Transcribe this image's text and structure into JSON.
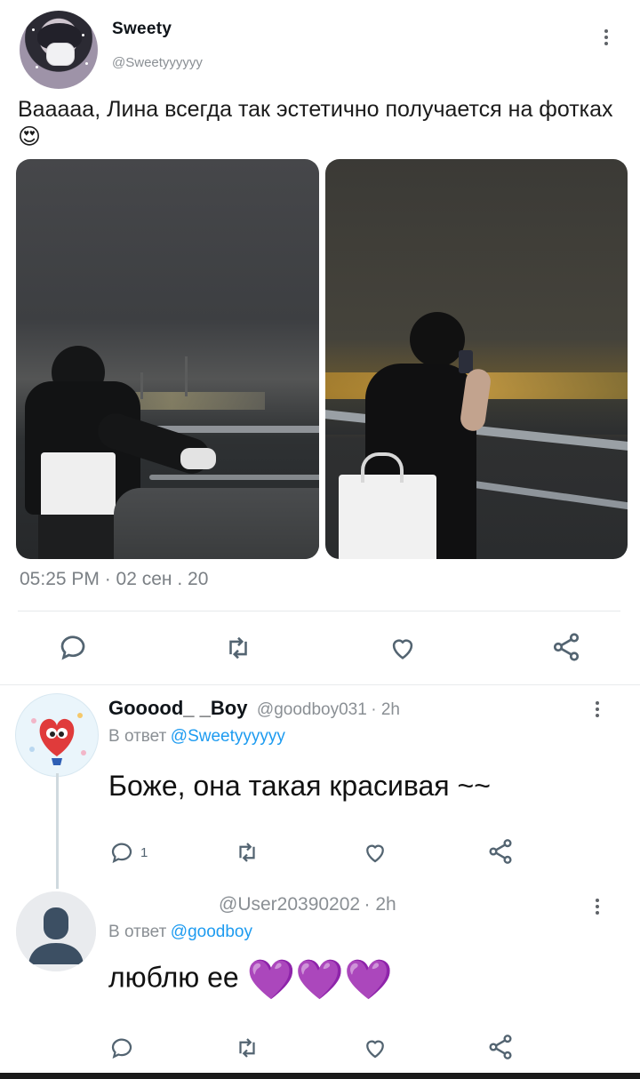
{
  "main_tweet": {
    "author_name": "Sweety",
    "author_handle": "@Sweetyyyyyy",
    "text": "Вааааа, Лина всегда так эстетично получается на фотках",
    "emoji": "😍",
    "timestamp": "05:25 PM · 02 сен . 20"
  },
  "replies": [
    {
      "author_name": "Gooood_ _Boy",
      "author_handle": "@goodboy031",
      "time": "· 2h",
      "reply_to_label": "В ответ",
      "reply_to_handle": "@Sweetyyyyyy",
      "text": "Боже, она такая красивая ~~",
      "reply_count": "1"
    },
    {
      "author_name": "",
      "author_handle": "@User20390202",
      "time": "· 2h",
      "reply_to_label": "В ответ",
      "reply_to_handle": "@goodboy",
      "text": "люблю ее",
      "emoji": "💜💜💜"
    }
  ],
  "colors": {
    "accent": "#1d9bf0",
    "muted": "#8a8f94",
    "heart_emoji": "#9b3fd8"
  },
  "icons": [
    "reply-icon",
    "retweet-icon",
    "like-icon",
    "share-icon",
    "more-icon"
  ]
}
